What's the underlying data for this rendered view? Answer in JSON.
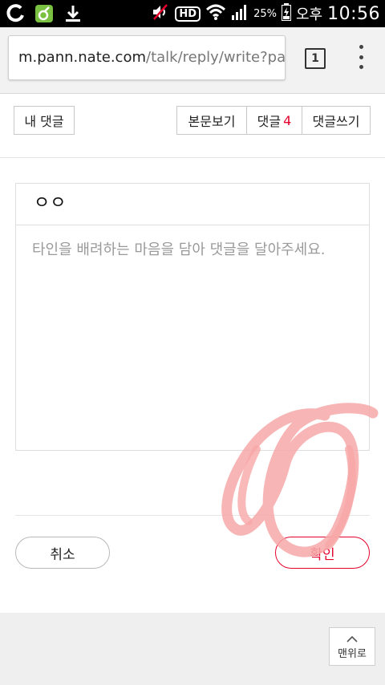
{
  "statusbar": {
    "battery_pct": "25%",
    "ampm": "오후",
    "time": "10:56",
    "hd_label": "HD"
  },
  "browser": {
    "url_host": "m.pann.nate.com",
    "url_path": "/talk/reply/write?pann",
    "tab_count": "1"
  },
  "nav": {
    "my_comments": "내 댓글",
    "view_post": "본문보기",
    "comments_label": "댓글",
    "comments_count": "4",
    "write_comment": "댓글쓰기"
  },
  "form": {
    "title_value": "ㅇㅇ",
    "placeholder": "타인을 배려하는 마음을 담아 댓글을 달아주세요."
  },
  "actions": {
    "cancel": "취소",
    "confirm": "확인"
  },
  "footer": {
    "to_top": "맨위로"
  },
  "colors": {
    "accent_red": "#e4002b",
    "scribble_pink": "#f7a8a8"
  }
}
